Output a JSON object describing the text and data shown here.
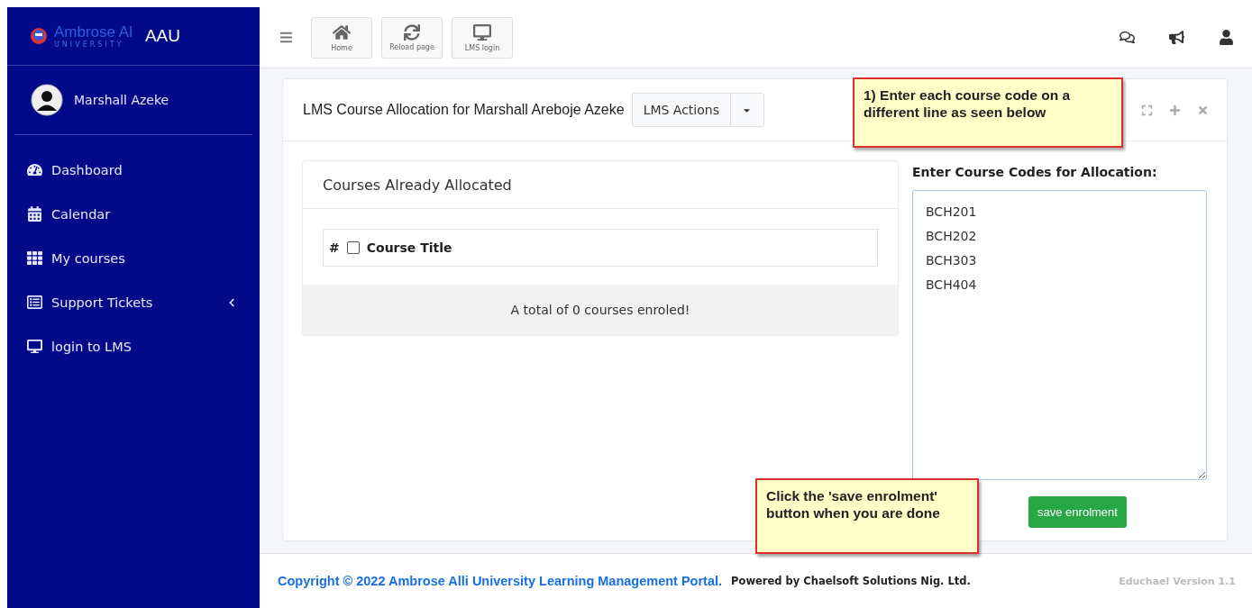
{
  "brand": {
    "logo_text": "Ambrose Al",
    "logo_subtext": "UNIVERSITY",
    "short": "AAU"
  },
  "user": {
    "name": "Marshall Azeke"
  },
  "sidebar": {
    "items": [
      {
        "label": "Dashboard",
        "kind": "dashboard",
        "has_submenu": false
      },
      {
        "label": "Calendar",
        "kind": "calendar",
        "has_submenu": false
      },
      {
        "label": "My courses",
        "kind": "grid",
        "has_submenu": false
      },
      {
        "label": "Support Tickets",
        "kind": "tickets",
        "has_submenu": true
      },
      {
        "label": "login to LMS",
        "kind": "monitor",
        "has_submenu": false
      }
    ]
  },
  "toolbar": {
    "buttons": [
      {
        "label": "Home",
        "kind": "home"
      },
      {
        "label": "Reload page",
        "kind": "reload"
      },
      {
        "label": "LMS login",
        "kind": "monitor"
      }
    ]
  },
  "card": {
    "title": "LMS Course Allocation for Marshall Areboje Azeke",
    "actions_button": "LMS Actions"
  },
  "allocated": {
    "title": "Courses Already Allocated",
    "columns": [
      "#",
      "Course Title"
    ],
    "select_all_checked": false,
    "summary": "A total of 0 courses enroled!"
  },
  "entry": {
    "label": "Enter Course Codes for Allocation:",
    "value": "BCH201\nBCH202\nBCH303\nBCH404",
    "button": "save enrolment"
  },
  "callouts": [
    {
      "text": "1) Enter each course code on a different line as seen below"
    },
    {
      "text": "Click the 'save enrolment' button when you are done"
    }
  ],
  "footer": {
    "copyright": "Copyright © 2022 Ambrose Alli University Learning Management Portal.",
    "powered_by": "Powered by Chaelsoft Solutions Nig. Ltd.",
    "version": "Educhael Version 1.1"
  }
}
